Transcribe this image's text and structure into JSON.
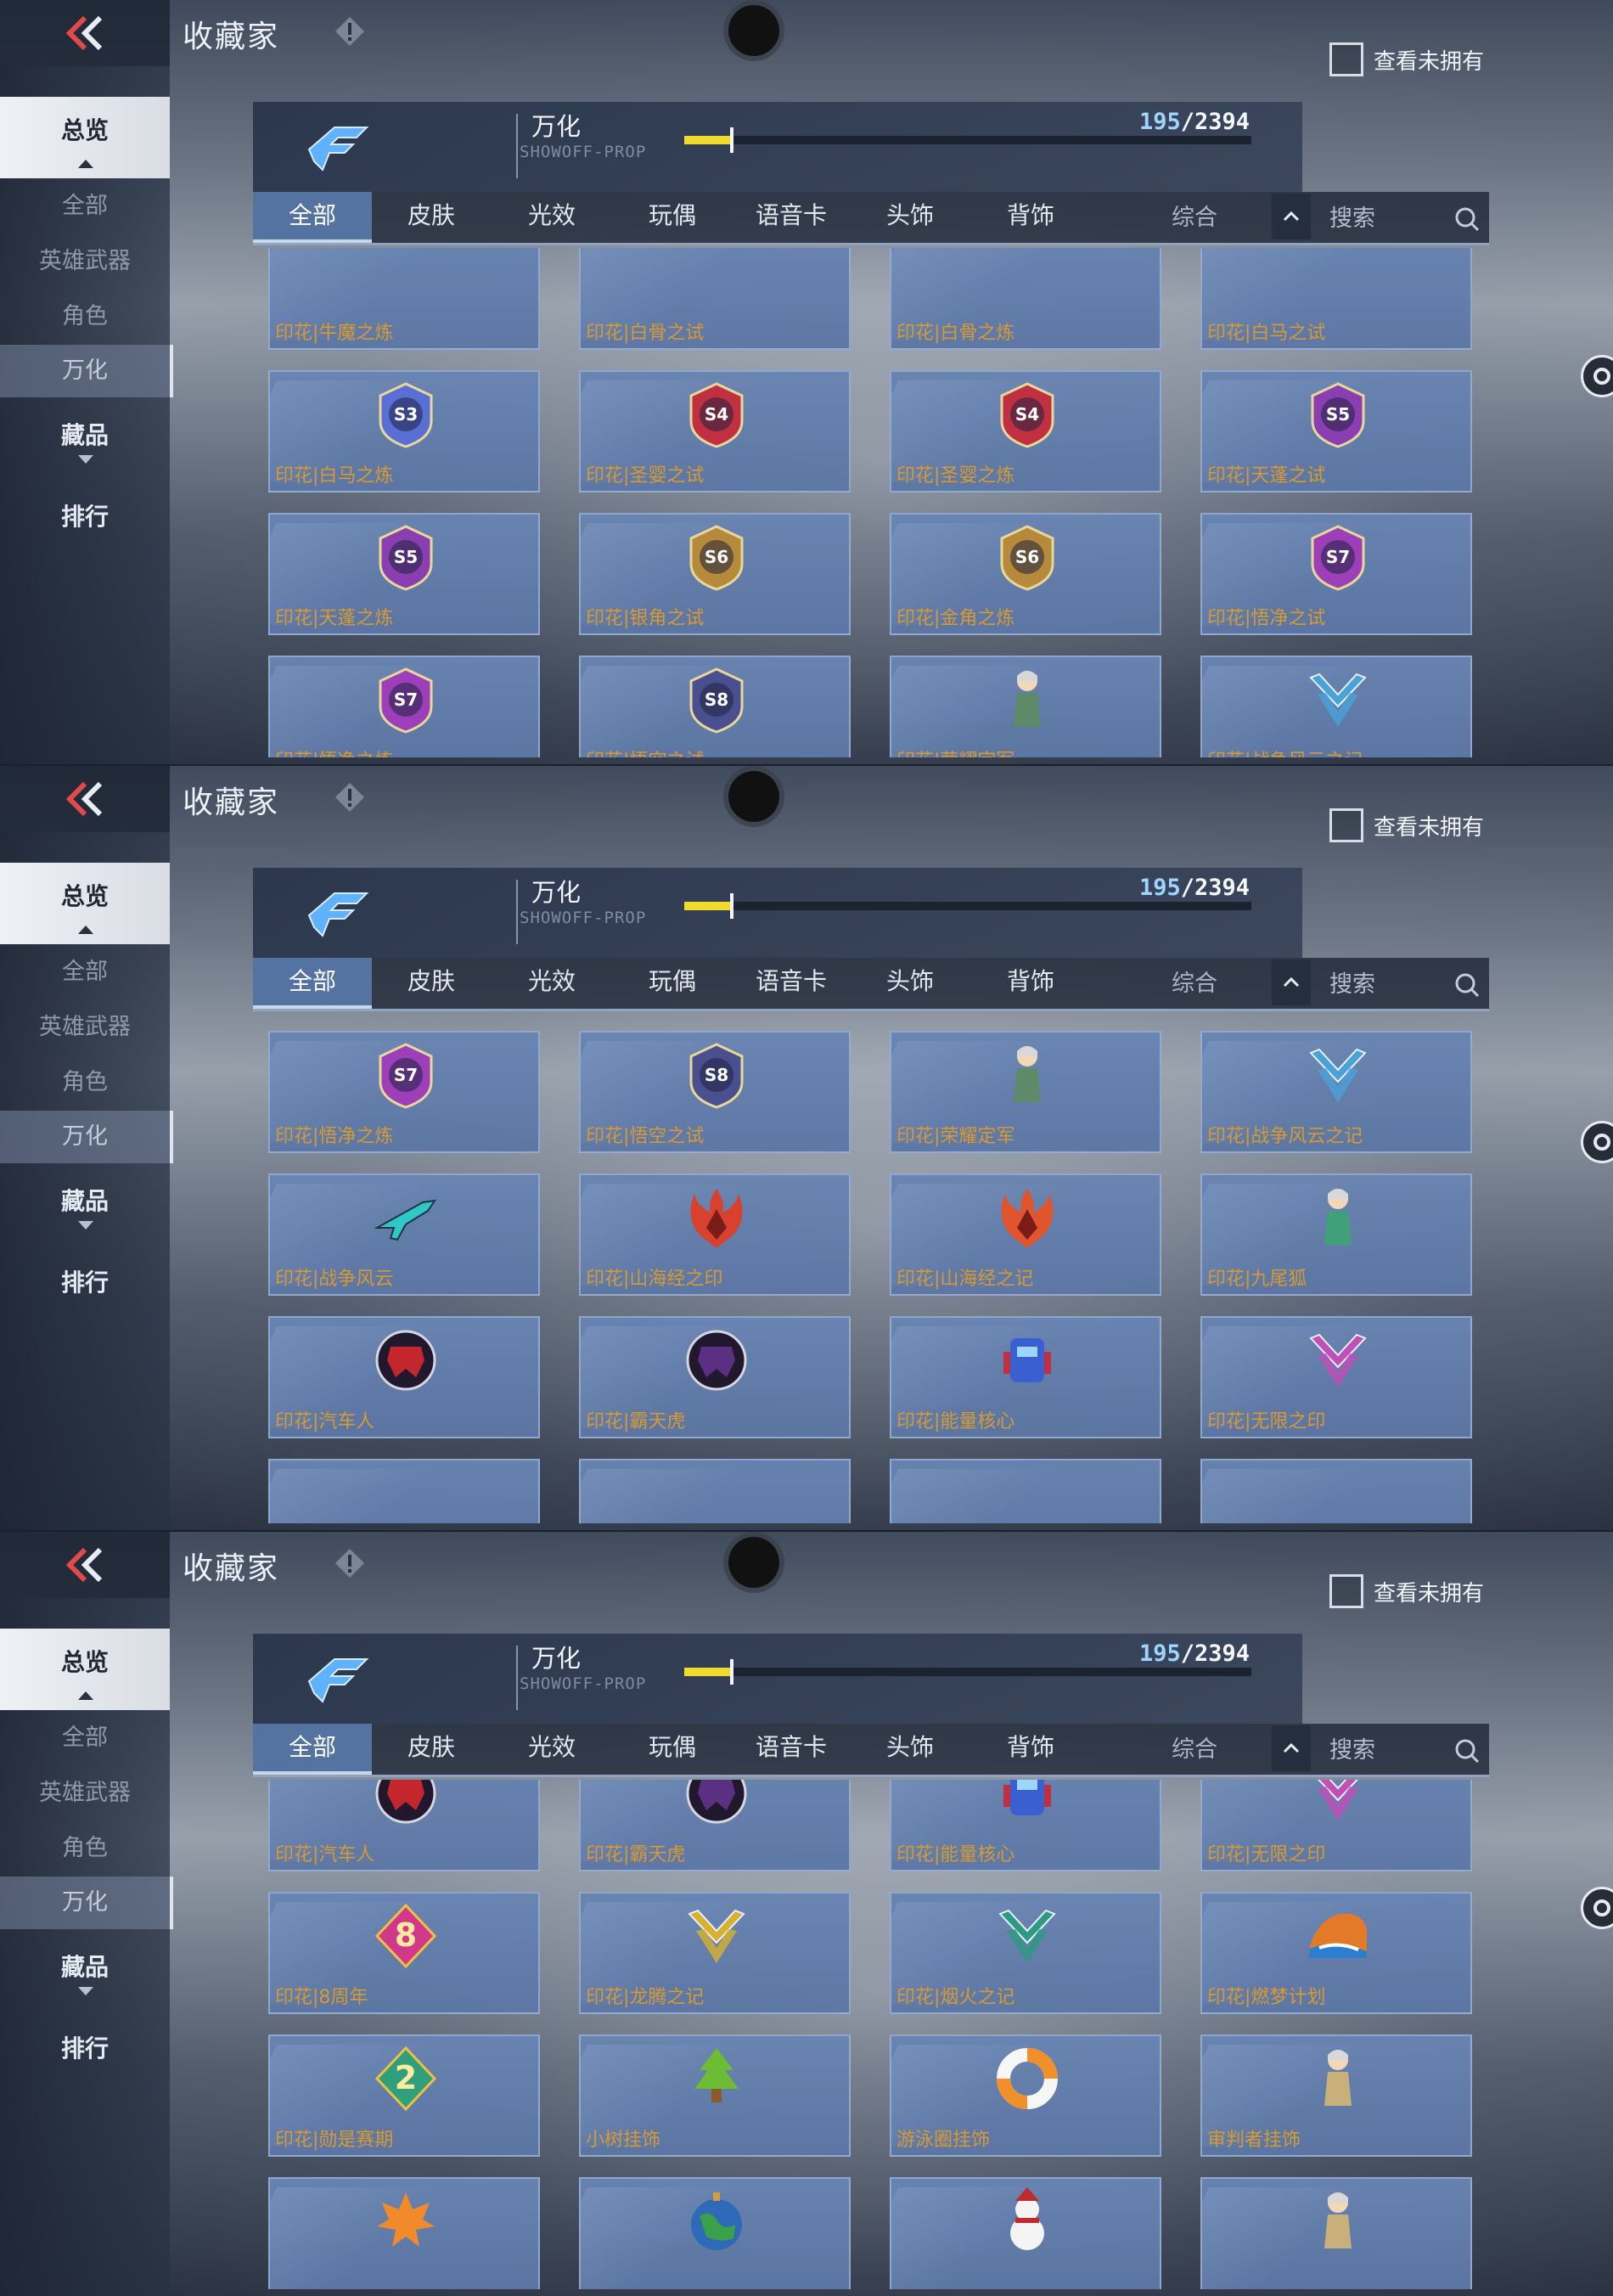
{
  "header": {
    "title": "收藏家",
    "show_unowned_label": "查看未拥有",
    "category_name": "万化",
    "category_sub": "SHOWOFF-PROP",
    "progress_owned": "195",
    "progress_sep_total": "/2394",
    "progress_fraction": 0.0815
  },
  "sidebar": {
    "overview": "总览",
    "all": "全部",
    "hero_weapons": "英雄武器",
    "roles": "角色",
    "wanhua": "万化",
    "collection": "藏品",
    "ranking": "排行"
  },
  "tabs": [
    "全部",
    "皮肤",
    "光效",
    "玩偶",
    "语音卡",
    "头饰",
    "背饰"
  ],
  "sort_label": "综合",
  "search_placeholder": "搜索",
  "colors": {
    "accent_yellow": "#f0da2e",
    "card_blue": "#6984b2",
    "item_name_orange": "#d79a31"
  },
  "panels": [
    {
      "rows": [
        {
          "offset": -24,
          "clip": true,
          "items": [
            {
              "name": "印花|牛魔之炼",
              "icon": "none"
            },
            {
              "name": "印花|白骨之试",
              "icon": "none"
            },
            {
              "name": "印花|白骨之炼",
              "icon": "none"
            },
            {
              "name": "印花|白马之试",
              "icon": "none"
            }
          ]
        },
        {
          "items": [
            {
              "name": "印花|白马之炼",
              "icon": "season-badge",
              "label": "S3",
              "color": "#5a6fd6"
            },
            {
              "name": "印花|圣婴之试",
              "icon": "season-badge",
              "label": "S4",
              "color": "#c03040"
            },
            {
              "name": "印花|圣婴之炼",
              "icon": "season-badge",
              "label": "S4",
              "color": "#c03040"
            },
            {
              "name": "印花|天蓬之试",
              "icon": "season-badge",
              "label": "S5",
              "color": "#8a3fb0"
            }
          ]
        },
        {
          "items": [
            {
              "name": "印花|天蓬之炼",
              "icon": "season-badge",
              "label": "S5",
              "color": "#8a3fb0"
            },
            {
              "name": "印花|银角之试",
              "icon": "season-badge",
              "label": "S6",
              "color": "#b58a3a"
            },
            {
              "name": "印花|金角之炼",
              "icon": "season-badge",
              "label": "S6",
              "color": "#b58a3a"
            },
            {
              "name": "印花|悟净之试",
              "icon": "season-badge",
              "label": "S7",
              "color": "#9c3fb8"
            }
          ]
        },
        {
          "items": [
            {
              "name": "印花|悟净之炼",
              "icon": "season-badge",
              "label": "S7",
              "color": "#9c3fb8"
            },
            {
              "name": "印花|悟空之试",
              "icon": "season-badge",
              "label": "S8",
              "color": "#4a4f8f"
            },
            {
              "name": "印花|荣耀定军",
              "icon": "figure",
              "color": "#5f8a6a"
            },
            {
              "name": "印花|战争风云之记",
              "icon": "chevron-emblem",
              "color": "#4aa3d8"
            }
          ]
        }
      ]
    },
    {
      "rows": [
        {
          "offset": 20,
          "items": [
            {
              "name": "印花|悟净之炼",
              "icon": "season-badge",
              "label": "S7",
              "color": "#9c3fb8"
            },
            {
              "name": "印花|悟空之试",
              "icon": "season-badge",
              "label": "S8",
              "color": "#4a4f8f"
            },
            {
              "name": "印花|荣耀定军",
              "icon": "figure",
              "color": "#5f8a6a"
            },
            {
              "name": "印花|战争风云之记",
              "icon": "chevron-emblem",
              "color": "#4aa3d8"
            }
          ]
        },
        {
          "items": [
            {
              "name": "印花|战争风云",
              "icon": "aircraft",
              "color": "#2fc8c8"
            },
            {
              "name": "印花|山海经之印",
              "icon": "flame-emblem",
              "color": "#d8412e"
            },
            {
              "name": "印花|山海经之记",
              "icon": "flame-emblem",
              "color": "#e0552e"
            },
            {
              "name": "印花|九尾狐",
              "icon": "figure",
              "color": "#3fa07a"
            }
          ]
        },
        {
          "items": [
            {
              "name": "印花|汽车人",
              "icon": "round-emblem",
              "color": "#c4262e"
            },
            {
              "name": "印花|霸天虎",
              "icon": "round-emblem",
              "color": "#5b2f82"
            },
            {
              "name": "印花|能量核心",
              "icon": "robot",
              "color": "#3a5fd0"
            },
            {
              "name": "印花|无限之印",
              "icon": "chevron-emblem",
              "color": "#c04fb8"
            }
          ]
        },
        {
          "clip": true,
          "items": [
            {
              "name": "",
              "icon": "none"
            },
            {
              "name": "",
              "icon": "none"
            },
            {
              "name": "",
              "icon": "none"
            },
            {
              "name": "",
              "icon": "none"
            }
          ]
        }
      ]
    },
    {
      "rows": [
        {
          "offset": -36,
          "items": [
            {
              "name": "印花|汽车人",
              "icon": "round-emblem",
              "color": "#c4262e"
            },
            {
              "name": "印花|霸天虎",
              "icon": "round-emblem",
              "color": "#5b2f82"
            },
            {
              "name": "印花|能量核心",
              "icon": "robot",
              "color": "#3a5fd0"
            },
            {
              "name": "印花|无限之印",
              "icon": "chevron-emblem",
              "color": "#c04fb8"
            }
          ]
        },
        {
          "items": [
            {
              "name": "印花|8周年",
              "icon": "number-emblem",
              "label": "8",
              "color": "#d2388a"
            },
            {
              "name": "印花|龙腾之记",
              "icon": "chevron-emblem",
              "color": "#d8b22e"
            },
            {
              "name": "印花|烟火之记",
              "icon": "chevron-emblem",
              "color": "#2d9a82"
            },
            {
              "name": "印花|燃梦计划",
              "icon": "wave",
              "color": "#e27a2a"
            }
          ]
        },
        {
          "items": [
            {
              "name": "印花|勋是赛期",
              "icon": "number-emblem",
              "label": "2",
              "color": "#2fa07a"
            },
            {
              "name": "小树挂饰",
              "icon": "tree",
              "color": "#6cbc34"
            },
            {
              "name": "游泳圈挂饰",
              "icon": "ring",
              "color": "#f0902a"
            },
            {
              "name": "审判者挂饰",
              "icon": "figure",
              "color": "#c9b07a"
            }
          ]
        },
        {
          "items": [
            {
              "name": "",
              "icon": "leaf",
              "color": "#f08a2a"
            },
            {
              "name": "",
              "icon": "globe",
              "color": "#2f6ab8"
            },
            {
              "name": "",
              "icon": "snowman",
              "color": "#f4f4f4"
            },
            {
              "name": "",
              "icon": "figure",
              "color": "#c9b07a"
            }
          ]
        }
      ]
    }
  ]
}
